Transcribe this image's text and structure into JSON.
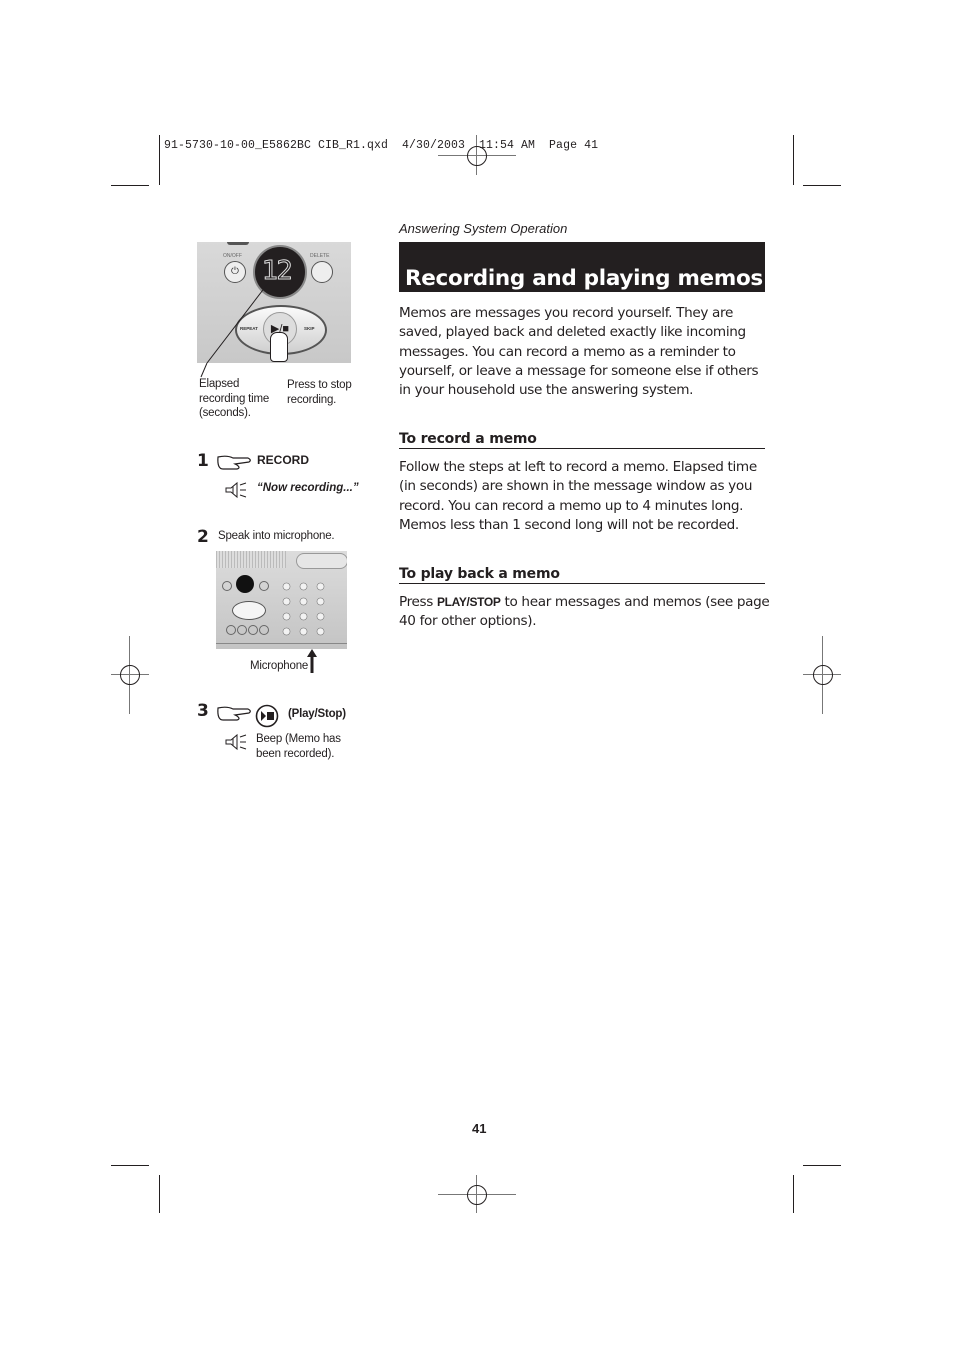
{
  "slug": "91-5730-10-00_E5862BC CIB_R1.qxd  4/30/2003  11:54 AM  Page 41",
  "header": {
    "section": "Answering System Operation",
    "title": "Recording and playing memos"
  },
  "intro": "Memos are messages you record yourself. They are saved, played back and deleted exactly like incoming messages. You can record a memo as a reminder to yourself, or leave a message for someone else if others in your household use the answering system.",
  "sections": [
    {
      "heading": "To record a memo",
      "body": "Follow the steps at left to record a memo. Elapsed time (in seconds) are shown in the message window as you record. You can record a memo up to 4 minutes long. Memos less than 1 second long will not be recorded."
    },
    {
      "heading": "To play back a memo",
      "body_prefix": "Press ",
      "body_key": "PLAY/STOP",
      "body_suffix": " to hear messages and memos (see page 40 for other options)."
    }
  ],
  "illustration": {
    "display_value": "12",
    "buttons": {
      "on_off": "ON/OFF",
      "delete": "DELETE",
      "repeat": "REPEAT",
      "skip": "SKIP"
    },
    "callout_left": "Elapsed recording time (seconds).",
    "callout_right": "Press to stop recording."
  },
  "steps": [
    {
      "number": "1",
      "action": "RECORD",
      "audio": "“Now recording...”"
    },
    {
      "number": "2",
      "action": "Speak into microphone.",
      "callout": "Microphone"
    },
    {
      "number": "3",
      "action": "(Play/Stop)",
      "audio": "Beep (Memo has been recorded)."
    }
  ],
  "page_number": "41"
}
